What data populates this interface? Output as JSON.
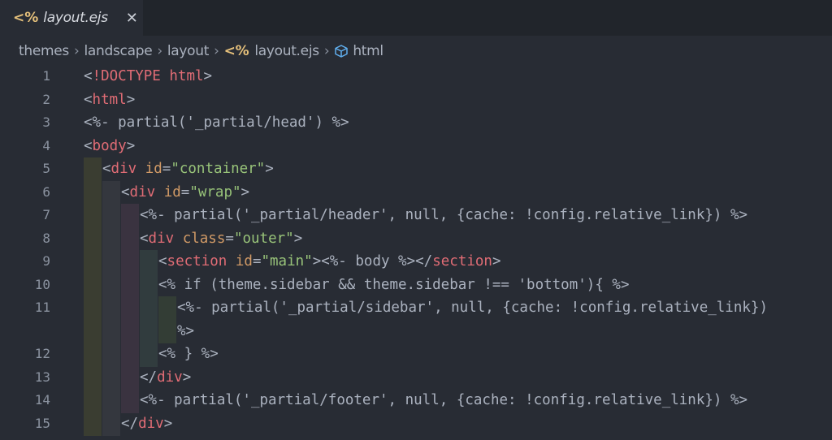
{
  "tab": {
    "icon": "<%",
    "title": "layout.ejs",
    "close": "✕"
  },
  "breadcrumb": [
    "themes",
    "landscape",
    "layout",
    "layout.ejs",
    "html"
  ],
  "lines": [
    {
      "n": "1",
      "parts": [
        [
          "p",
          "<"
        ],
        [
          "t",
          "!DOCTYPE html"
        ],
        [
          "p",
          ">"
        ]
      ],
      "ind": 0
    },
    {
      "n": "2",
      "parts": [
        [
          "p",
          "<"
        ],
        [
          "t",
          "html"
        ],
        [
          "p",
          ">"
        ]
      ],
      "ind": 0
    },
    {
      "n": "3",
      "parts": [
        [
          "p",
          "<%- partial('_partial/head') %>"
        ]
      ],
      "ind": 0
    },
    {
      "n": "4",
      "parts": [
        [
          "p",
          "<"
        ],
        [
          "t",
          "body"
        ],
        [
          "p",
          ">"
        ]
      ],
      "ind": 0
    },
    {
      "n": "5",
      "parts": [
        [
          "p",
          "<"
        ],
        [
          "t",
          "div"
        ],
        [
          "p",
          " "
        ],
        [
          "a",
          "id"
        ],
        [
          "p",
          "="
        ],
        [
          "s",
          "\"container\""
        ],
        [
          "p",
          ">"
        ]
      ],
      "ind": 1
    },
    {
      "n": "6",
      "parts": [
        [
          "p",
          "<"
        ],
        [
          "t",
          "div"
        ],
        [
          "p",
          " "
        ],
        [
          "a",
          "id"
        ],
        [
          "p",
          "="
        ],
        [
          "s",
          "\"wrap\""
        ],
        [
          "p",
          ">"
        ]
      ],
      "ind": 2
    },
    {
      "n": "7",
      "parts": [
        [
          "p",
          "<%- partial('_partial/header', null, {cache: !config.relative_link}) %>"
        ]
      ],
      "ind": 3
    },
    {
      "n": "8",
      "parts": [
        [
          "p",
          "<"
        ],
        [
          "t",
          "div"
        ],
        [
          "p",
          " "
        ],
        [
          "a",
          "class"
        ],
        [
          "p",
          "="
        ],
        [
          "s",
          "\"outer\""
        ],
        [
          "p",
          ">"
        ]
      ],
      "ind": 3
    },
    {
      "n": "9",
      "parts": [
        [
          "p",
          "<"
        ],
        [
          "t",
          "section"
        ],
        [
          "p",
          " "
        ],
        [
          "a",
          "id"
        ],
        [
          "p",
          "="
        ],
        [
          "s",
          "\"main\""
        ],
        [
          "p",
          "><%- body %></"
        ],
        [
          "t",
          "section"
        ],
        [
          "p",
          ">"
        ]
      ],
      "ind": 4
    },
    {
      "n": "10",
      "parts": [
        [
          "p",
          "<% if (theme.sidebar && theme.sidebar !== 'bottom'){ %>"
        ]
      ],
      "ind": 4
    },
    {
      "n": "11",
      "parts": [
        [
          "p",
          "<%- partial('_partial/sidebar', null, {cache: !config.relative_link})"
        ]
      ],
      "ind": 5
    },
    {
      "n": "",
      "parts": [
        [
          "p",
          "%>"
        ]
      ],
      "ind": 5
    },
    {
      "n": "12",
      "parts": [
        [
          "p",
          "<% } %>"
        ]
      ],
      "ind": 4
    },
    {
      "n": "13",
      "parts": [
        [
          "p",
          "</"
        ],
        [
          "t",
          "div"
        ],
        [
          "p",
          ">"
        ]
      ],
      "ind": 3
    },
    {
      "n": "14",
      "parts": [
        [
          "p",
          "<%- partial('_partial/footer', null, {cache: !config.relative_link}) %>"
        ]
      ],
      "ind": 3
    },
    {
      "n": "15",
      "parts": [
        [
          "p",
          "</"
        ],
        [
          "t",
          "div"
        ],
        [
          "p",
          ">"
        ]
      ],
      "ind": 2
    }
  ],
  "colors": {
    "tag": "#e06c75",
    "attr": "#d19a66",
    "string": "#98c379",
    "text": "#abb2bf",
    "ejs_icon": "#e5c07b",
    "cube_icon": "#61afef"
  }
}
